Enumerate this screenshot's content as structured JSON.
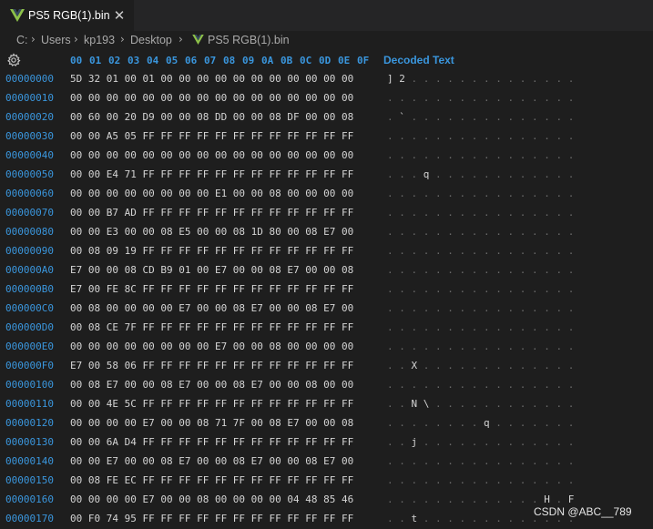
{
  "tab": {
    "title": "PS5 RGB(1).bin",
    "close": "✕"
  },
  "breadcrumb": [
    "C:",
    "Users",
    "kp193",
    "Desktop",
    "PS5 RGB(1).bin"
  ],
  "header": {
    "columns": [
      "00",
      "01",
      "02",
      "03",
      "04",
      "05",
      "06",
      "07",
      "08",
      "09",
      "0A",
      "0B",
      "0C",
      "0D",
      "0E",
      "0F"
    ],
    "decoded_label": "Decoded Text"
  },
  "rows": [
    {
      "addr": "00000000",
      "bytes": "5D 32 01 00 01 00 00 00 00 00 00 00 00 00 00 00",
      "text": "]2.............."
    },
    {
      "addr": "00000010",
      "bytes": "00 00 00 00 00 00 00 00 00 00 00 00 00 00 00 00",
      "text": "................"
    },
    {
      "addr": "00000020",
      "bytes": "00 60 00 20 D9 00 00 08 DD 00 00 08 DF 00 00 08",
      "text": ".`.............."
    },
    {
      "addr": "00000030",
      "bytes": "00 00 A5 05 FF FF FF FF FF FF FF FF FF FF FF FF",
      "text": "................"
    },
    {
      "addr": "00000040",
      "bytes": "00 00 00 00 00 00 00 00 00 00 00 00 00 00 00 00",
      "text": "................"
    },
    {
      "addr": "00000050",
      "bytes": "00 00 E4 71 FF FF FF FF FF FF FF FF FF FF FF FF",
      "text": "...q............"
    },
    {
      "addr": "00000060",
      "bytes": "00 00 00 00 00 00 00 00 E1 00 00 08 00 00 00 00",
      "text": "................"
    },
    {
      "addr": "00000070",
      "bytes": "00 00 B7 AD FF FF FF FF FF FF FF FF FF FF FF FF",
      "text": "................"
    },
    {
      "addr": "00000080",
      "bytes": "00 00 E3 00 00 08 E5 00 00 08 1D 80 00 08 E7 00",
      "text": "................"
    },
    {
      "addr": "00000090",
      "bytes": "00 08 09 19 FF FF FF FF FF FF FF FF FF FF FF FF",
      "text": "................"
    },
    {
      "addr": "000000A0",
      "bytes": "E7 00 00 08 CD B9 01 00 E7 00 00 08 E7 00 00 08",
      "text": "................"
    },
    {
      "addr": "000000B0",
      "bytes": "E7 00 FE 8C FF FF FF FF FF FF FF FF FF FF FF FF",
      "text": "................"
    },
    {
      "addr": "000000C0",
      "bytes": "00 08 00 00 00 00 E7 00 00 08 E7 00 00 08 E7 00",
      "text": "................"
    },
    {
      "addr": "000000D0",
      "bytes": "00 08 CE 7F FF FF FF FF FF FF FF FF FF FF FF FF",
      "text": "................"
    },
    {
      "addr": "000000E0",
      "bytes": "00 00 00 00 00 00 00 00 E7 00 00 08 00 00 00 00",
      "text": "................"
    },
    {
      "addr": "000000F0",
      "bytes": "E7 00 58 06 FF FF FF FF FF FF FF FF FF FF FF FF",
      "text": "..X............."
    },
    {
      "addr": "00000100",
      "bytes": "00 08 E7 00 00 08 E7 00 00 08 E7 00 00 08 00 00",
      "text": "................"
    },
    {
      "addr": "00000110",
      "bytes": "00 00 4E 5C FF FF FF FF FF FF FF FF FF FF FF FF",
      "text": "..N\\............"
    },
    {
      "addr": "00000120",
      "bytes": "00 00 00 00 E7 00 00 08 71 7F 00 08 E7 00 00 08",
      "text": "........q......."
    },
    {
      "addr": "00000130",
      "bytes": "00 00 6A D4 FF FF FF FF FF FF FF FF FF FF FF FF",
      "text": "..j............."
    },
    {
      "addr": "00000140",
      "bytes": "00 00 E7 00 00 08 E7 00 00 08 E7 00 00 08 E7 00",
      "text": "................"
    },
    {
      "addr": "00000150",
      "bytes": "00 08 FE EC FF FF FF FF FF FF FF FF FF FF FF FF",
      "text": "................"
    },
    {
      "addr": "00000160",
      "bytes": "00 00 00 00 E7 00 00 08 00 00 00 00 04 48 85 46",
      "text": ".............H.F"
    },
    {
      "addr": "00000170",
      "bytes": "00 F0 74 95 FF FF FF FF FF FF FF FF FF FF FF FF",
      "text": "..t............."
    }
  ],
  "watermark": "CSDN @ABC__789",
  "colors": {
    "accent": "#3a96dd",
    "background": "#1e1e1e",
    "tab_icon": "#8dc149"
  }
}
